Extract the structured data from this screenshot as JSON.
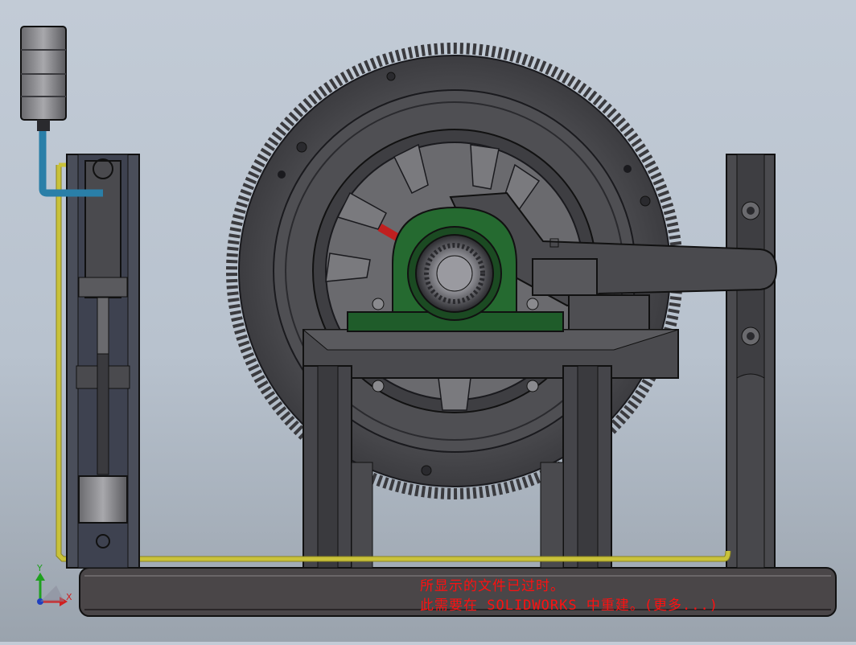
{
  "app": "SOLIDWORKS",
  "viewport": {
    "background_top": "#c2cbd6",
    "background_bottom": "#9aa3ad",
    "model_color": "#4a4a4e",
    "bearing_color": "#1f5c2a",
    "pipe_yellow": "#c9c23a",
    "pipe_blue": "#2a7fa8"
  },
  "warning": {
    "line1": "所显示的文件已过时。",
    "line2": "此需要在 SOLIDWORKS 中重建。(更多...)",
    "color": "#ff1010"
  },
  "triad": {
    "x_label": "X",
    "y_label": "Y"
  }
}
